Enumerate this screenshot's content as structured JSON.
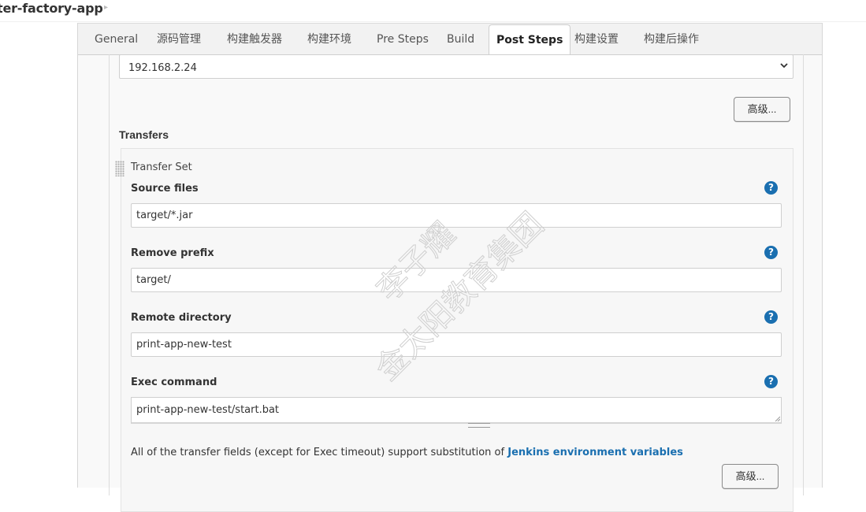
{
  "breadcrumb": {
    "project": "ter-factory-app"
  },
  "tabs": [
    {
      "label": "General"
    },
    {
      "label": "源码管理"
    },
    {
      "label": "构建触发器"
    },
    {
      "label": "构建环境"
    },
    {
      "label": "Pre Steps"
    },
    {
      "label": "Build"
    },
    {
      "label": "Post Steps",
      "active": true
    },
    {
      "label": "构建设置"
    },
    {
      "label": "构建后操作"
    }
  ],
  "server": {
    "selected": "192.168.2.24"
  },
  "advanced_label": "高级...",
  "transfers": {
    "title": "Transfers",
    "set_title": "Transfer Set",
    "source_files": {
      "label": "Source files",
      "value": "target/*.jar"
    },
    "remove_prefix": {
      "label": "Remove prefix",
      "value": "target/"
    },
    "remote_directory": {
      "label": "Remote directory",
      "value": "print-app-new-test"
    },
    "exec_command": {
      "label": "Exec command",
      "value": "print-app-new-test/start.bat"
    },
    "help_glyph": "?",
    "note_text": "All of the transfer fields (except for Exec timeout) support substitution of ",
    "note_link": "Jenkins environment variables"
  },
  "watermark": {
    "line1": "李子耀",
    "line2": "金太阳教育集团"
  },
  "colors": {
    "link": "#1a6fb0",
    "help_icon": "#1a6fb0"
  }
}
